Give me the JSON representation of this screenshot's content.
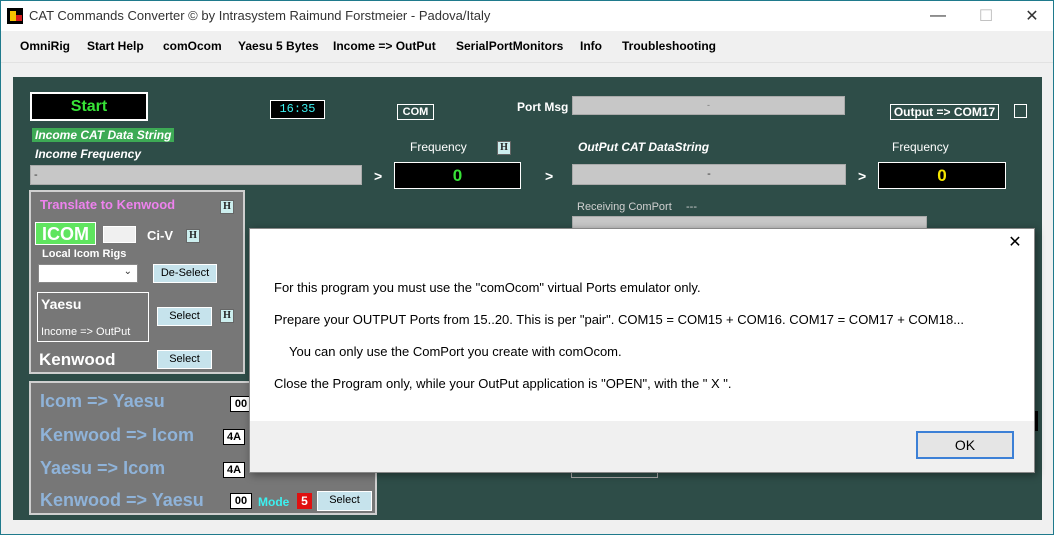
{
  "window": {
    "title": "CAT Commands Converter © by Intrasystem Raimund Forstmeier - Padova/Italy",
    "minimize": "—",
    "maximize": "☐",
    "close": "✕"
  },
  "menu": [
    "OmniRig",
    "Start Help",
    "comOcom",
    "Yaesu 5 Bytes",
    "Income => OutPut",
    "SerialPortMonitors",
    "Info",
    "Troubleshooting"
  ],
  "main": {
    "start_label": "Start",
    "clock": "16:35",
    "com_label": "COM",
    "port_msg_label": "Port Msg",
    "port_msg_value": "-",
    "output_com_label": "Output => COM17",
    "income_cat_label": "Income CAT Data String",
    "income_freq_label": "Income Frequency",
    "frequency_label": "Frequency",
    "h_label": "H",
    "output_cat_label": "OutPut CAT DataString",
    "income_value": "-",
    "arrow": ">",
    "income_freq_value": "0",
    "output_value": "-",
    "output_freq_value": "0",
    "receiving_comport_label": "Receiving ComPort",
    "receiving_comport_value": "---"
  },
  "translate": {
    "title": "Translate to Kenwood",
    "icom_label": "ICOM",
    "civ_label": "Ci-V",
    "local_icom_rigs_label": "Local  Icom Rigs",
    "deselect_label": "De-Select",
    "yaesu_label": "Yaesu",
    "yaesu_sub": "Income => OutPut",
    "select_label": "Select",
    "kenwood_label": "Kenwood"
  },
  "conversions": [
    {
      "label": "Icom => Yaesu",
      "code": "00"
    },
    {
      "label": "Kenwood => Icom",
      "code": "4A"
    },
    {
      "label": "Yaesu => Icom",
      "code": "4A"
    },
    {
      "label": "Kenwood => Yaesu",
      "code": "00"
    }
  ],
  "mode": {
    "label": "Mode",
    "value": "5",
    "select_label": "Select"
  },
  "dialog": {
    "lines": [
      "For this program you must use the \"comOcom\" virtual Ports emulator only.",
      "Prepare your OUTPUT Ports from 15..20. This is per \"pair\". COM15 = COM15 + COM16. COM17 = COM17 + COM18...",
      "You can only use the ComPort you create with comOcom.",
      "Close the Program only, while your OutPut application is \"OPEN\", with the \" X \"."
    ],
    "ok_label": "OK",
    "close_label": "✕"
  },
  "colors": {
    "client_bg": "#2e4d48",
    "panel_bg": "#777777",
    "start_text": "#37e337",
    "freq_green": "#37e337",
    "freq_yellow": "#f5e600",
    "translate_title": "#ee82ee",
    "conv_label": "#8fb3d9"
  }
}
